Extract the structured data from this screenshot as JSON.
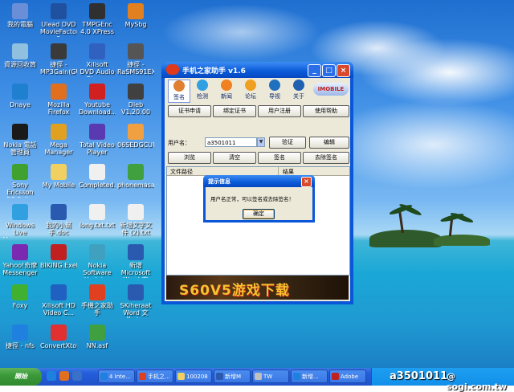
{
  "desktop": {
    "icons": [
      {
        "label": "我的電腦",
        "icon": "computer-icon",
        "color": "#6a8fd8"
      },
      {
        "label": "Ulead DVD MovieFactory 5",
        "icon": "dvd-icon",
        "color": "#2050a0"
      },
      {
        "label": "TMPGEnc 4.0 XPress",
        "icon": "video-icon",
        "color": "#303030"
      },
      {
        "label": "MySbg",
        "icon": "pen-icon",
        "color": "#e08020"
      },
      {
        "label": "資源回收筒",
        "icon": "recycle-bin-icon",
        "color": "#8fc0e0"
      },
      {
        "label": "捷徑 - MP3Gain(GU...",
        "icon": "mp3gain-icon",
        "color": "#3a3a3a"
      },
      {
        "label": "Xilisoft DVD Audio Ripper",
        "icon": "dvd-ripper-icon",
        "color": "#3060c0"
      },
      {
        "label": "捷徑 - RaSMS91EXE",
        "icon": "shortcut-icon",
        "color": "#555555"
      },
      {
        "label": "Dnaye",
        "icon": "network-icon",
        "color": "#2080d0"
      },
      {
        "label": "Mozilla Firefox",
        "icon": "firefox-icon",
        "color": "#e07020"
      },
      {
        "label": "Youtube Download...",
        "icon": "youtube-icon",
        "color": "#d02020"
      },
      {
        "label": "Dieb V1.20.00",
        "icon": "dieb-icon",
        "color": "#404040"
      },
      {
        "label": "Nokia 電話管理員",
        "icon": "phone-icon",
        "color": "#1a1a1a"
      },
      {
        "label": "Mega Manager",
        "icon": "mega-manager-icon",
        "color": "#e0a020"
      },
      {
        "label": "Total Video Player",
        "icon": "player-icon",
        "color": "#5a3ab0"
      },
      {
        "label": "06SEDGCUB...",
        "icon": "file-icon",
        "color": "#f0a040"
      },
      {
        "label": "Sony Ericsson PC Suite 6.0",
        "icon": "sony-ericsson-icon",
        "color": "#40a030"
      },
      {
        "label": "My Mobile",
        "icon": "folder-icon",
        "color": "#f0d060"
      },
      {
        "label": "Completed.txt",
        "icon": "text-file-icon",
        "color": "#f0f0f0"
      },
      {
        "label": "phonemasa...",
        "icon": "phone-app-icon",
        "color": "#40a040"
      },
      {
        "label": "Windows Live Messenger",
        "icon": "messenger-icon",
        "color": "#30a0e0"
      },
      {
        "label": "我的小幫手.doc",
        "icon": "word-doc-icon",
        "color": "#2a5ab0"
      },
      {
        "label": "long.txt.txt",
        "icon": "text-file-icon",
        "color": "#f0f0f0"
      },
      {
        "label": "新增文字文件 (2).txt",
        "icon": "text-file-icon",
        "color": "#f0f0f0"
      },
      {
        "label": "Yahoo!奇摩 Messenger",
        "icon": "yahoo-icon",
        "color": "#7a2ab0"
      },
      {
        "label": "BIKING.ExeMag...",
        "icon": "app-icon",
        "color": "#c02020"
      },
      {
        "label": "Nokia Software Updater",
        "icon": "updater-icon",
        "color": "#40a0c0"
      },
      {
        "label": "新增 Microsoft Word 文件.doc",
        "icon": "word-doc-icon",
        "color": "#2a5ab0"
      },
      {
        "label": "Foxy",
        "icon": "foxy-icon",
        "color": "#40b030"
      },
      {
        "label": "Xilisoft HD Video C...",
        "icon": "video-converter-icon",
        "color": "#2060c0"
      },
      {
        "label": "手機之家助手",
        "icon": "shortcut-icon",
        "color": "#e04020"
      },
      {
        "label": "SKiheraat Word 文件.doc",
        "icon": "word-doc-icon",
        "color": "#2a5ab0"
      },
      {
        "label": "捷徑 - nfs",
        "icon": "ie-icon",
        "color": "#2080e0"
      },
      {
        "label": "ConvertXtoDV...",
        "icon": "convert-icon",
        "color": "#e03030"
      },
      {
        "label": "NN.asf",
        "icon": "media-file-icon",
        "color": "#40a040"
      }
    ]
  },
  "window": {
    "title": "手机之家助手 v1.6",
    "min": "_",
    "max": "□",
    "close": "×",
    "toolbar": [
      {
        "label": "签名",
        "icon": "sign-icon",
        "color": "#e08030",
        "active": true
      },
      {
        "label": "检测",
        "icon": "detect-icon",
        "color": "#30a0e0"
      },
      {
        "label": "新闻",
        "icon": "rss-icon",
        "color": "#f08020"
      },
      {
        "label": "论坛",
        "icon": "forum-icon",
        "color": "#f0a020"
      },
      {
        "label": "导视",
        "icon": "search-icon",
        "color": "#2070c0"
      },
      {
        "label": "关于",
        "icon": "about-icon",
        "color": "#2060b0"
      }
    ],
    "logo": "IMOBILE",
    "buttons_row1": [
      "证书申请",
      "绑定证书",
      "用户注册",
      "使用帮助"
    ],
    "username_label": "用户名：",
    "username_value": "a3501011",
    "buttons_row2": [
      "验证",
      "编辑"
    ],
    "buttons_row3": [
      "浏览",
      "清空",
      "签名",
      "去除签名"
    ],
    "list": {
      "col_path": "文件路径",
      "col_result": "结果"
    },
    "banner": "S60V5游戏下载"
  },
  "dialog": {
    "title": "提示信息",
    "close": "×",
    "message": "用户名正常，可以签名或去除签名！",
    "ok": "确定"
  },
  "taskbar": {
    "start": "開始",
    "tasks": [
      {
        "label": "4 Inte...",
        "icon": "ie-icon",
        "color": "#2080e0"
      },
      {
        "label": "手机之...",
        "icon": "app-icon",
        "color": "#e04020"
      },
      {
        "label": "100208",
        "icon": "folder-icon",
        "color": "#f0d060"
      },
      {
        "label": "新增M",
        "icon": "word-icon",
        "color": "#2a5ab0"
      },
      {
        "label": "TW",
        "icon": "window-icon",
        "color": "#c0c0c0"
      },
      {
        "label": "新增...",
        "icon": "ie-icon",
        "color": "#2080e0"
      },
      {
        "label": "Adobe",
        "icon": "adobe-icon",
        "color": "#c02020"
      }
    ],
    "watermark_user": "a3501011",
    "watermark_site": "@ sogi.com.tw"
  }
}
